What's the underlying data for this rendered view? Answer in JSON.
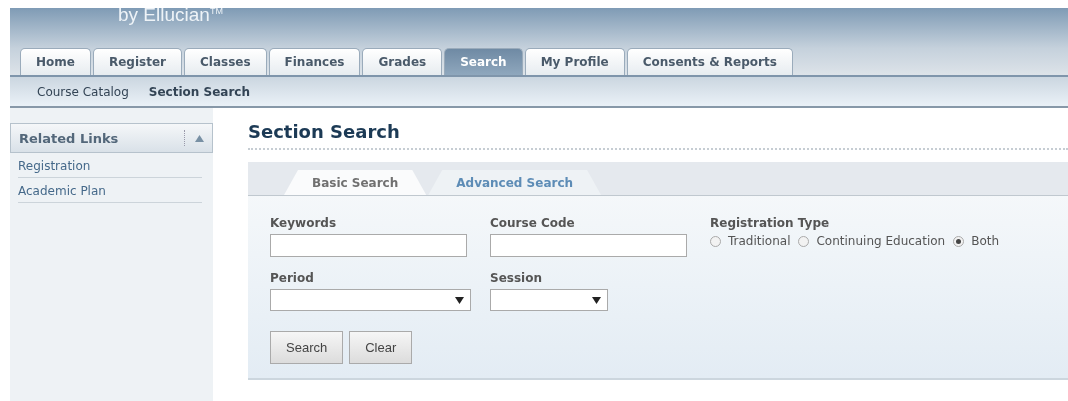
{
  "header": {
    "brand": "by Ellucian$^{TM}$"
  },
  "tabs": [
    {
      "label": "Home",
      "selected": false
    },
    {
      "label": "Register",
      "selected": false
    },
    {
      "label": "Classes",
      "selected": false
    },
    {
      "label": "Finances",
      "selected": false
    },
    {
      "label": "Grades",
      "selected": false
    },
    {
      "label": "Search",
      "selected": true
    },
    {
      "label": "My Profile",
      "selected": false
    },
    {
      "label": "Consents & Reports",
      "selected": false
    }
  ],
  "subnav": [
    {
      "label": "Course Catalog",
      "selected": false
    },
    {
      "label": "Section Search",
      "selected": true
    }
  ],
  "sidebar": {
    "title": "Related Links",
    "expanded": true,
    "items": [
      {
        "label": "Registration"
      },
      {
        "label": "Academic Plan"
      }
    ]
  },
  "page_title": "Section Search",
  "search_tabs": [
    {
      "label": "Basic Search",
      "selected": true
    },
    {
      "label": "Advanced Search",
      "selected": false
    }
  ],
  "form": {
    "keywords": {
      "label": "Keywords"
    },
    "course_code": {
      "label": "Course Code"
    },
    "registration_type": {
      "label": "Registration Type",
      "options": [
        {
          "label": "Traditional",
          "selected": false
        },
        {
          "label": "Continuing Education",
          "selected": false
        },
        {
          "label": "Both",
          "selected": true
        }
      ]
    },
    "period": {
      "label": "Period"
    },
    "session": {
      "label": "Session"
    }
  },
  "buttons": [
    {
      "label": "Search"
    },
    {
      "label": "Clear"
    }
  ]
}
